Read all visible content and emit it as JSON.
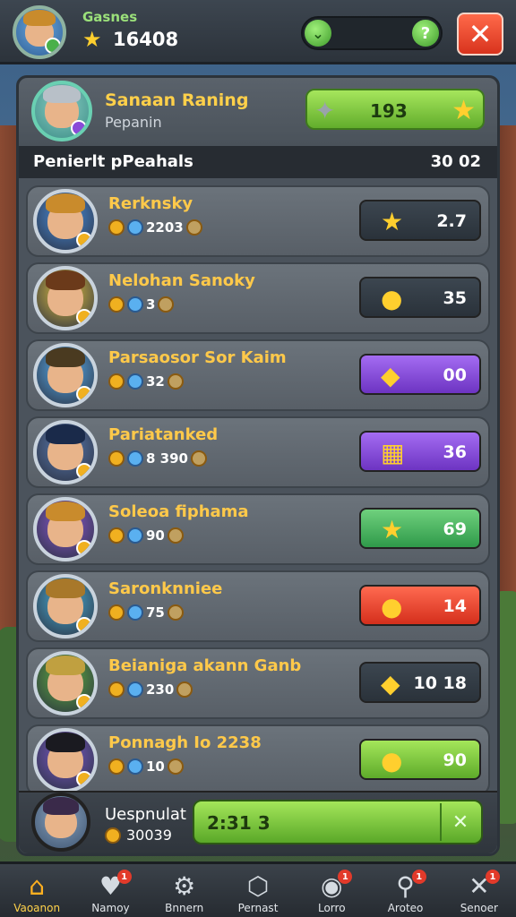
{
  "topbar": {
    "title": "Gasnes",
    "score": "16408",
    "star_icon": "star-icon",
    "progress_left_icon": "chevron-down-icon",
    "progress_right_icon": "help-icon"
  },
  "me": {
    "name": "Sanaan Raning",
    "subtitle": "Pepanin",
    "score": "193"
  },
  "section": {
    "title": "Penierlt pPeahals",
    "right": "30 02"
  },
  "rows": [
    {
      "name": "Rerknsky",
      "stats": "2203",
      "score": "2.7",
      "style": "dark",
      "hair": "#c98b2c",
      "bg": "#4a90e0"
    },
    {
      "name": "Nelohan Sanoky",
      "stats": "3",
      "score": "35",
      "style": "dark",
      "hair": "#6b3a1a",
      "bg": "#e0c040"
    },
    {
      "name": "Parsaosor Sor Kaim",
      "stats": "32",
      "score": "00",
      "style": "purple",
      "hair": "#4a3a20",
      "bg": "#5ab0f0"
    },
    {
      "name": "Pariatanked",
      "stats": "8 390",
      "score": "36",
      "style": "purple",
      "hair": "#1a2a4a",
      "bg": "#5a7ab0"
    },
    {
      "name": "Soleoa fiphama",
      "stats": "90",
      "score": "69",
      "style": "green",
      "hair": "#c98b2c",
      "bg": "#8a5ad0"
    },
    {
      "name": "Saronknniee",
      "stats": "75",
      "score": "14",
      "style": "red",
      "hair": "#a8782a",
      "bg": "#4ab0d8"
    },
    {
      "name": "Beianiga akann Ganb",
      "stats": "230",
      "score": "10 18",
      "style": "dark",
      "hair": "#c0a040",
      "bg": "#60b040"
    },
    {
      "name": "Ponnagh Io 2238",
      "stats": "10",
      "score": "90",
      "style": "lime",
      "hair": "#1a1a20",
      "bg": "#7a5ac8"
    }
  ],
  "bottom_me": {
    "name": "Uespnulat",
    "score": "30039",
    "bar_value": "2:31 3"
  },
  "nav": [
    {
      "label": "Vaoanon",
      "icon": "home-icon",
      "glyph": "⌂",
      "badge": ""
    },
    {
      "label": "Namoy",
      "icon": "bag-icon",
      "glyph": "♥",
      "badge": "1"
    },
    {
      "label": "Bnnern",
      "icon": "gear-icon",
      "glyph": "⚙",
      "badge": ""
    },
    {
      "label": "Pernast",
      "icon": "shield-icon",
      "glyph": "⬡",
      "badge": ""
    },
    {
      "label": "Lorro",
      "icon": "target-icon",
      "glyph": "◉",
      "badge": "1"
    },
    {
      "label": "Aroteo",
      "icon": "search-icon",
      "glyph": "⚲",
      "badge": "1"
    },
    {
      "label": "Senoer",
      "icon": "close-icon",
      "glyph": "✕",
      "badge": "1"
    }
  ]
}
